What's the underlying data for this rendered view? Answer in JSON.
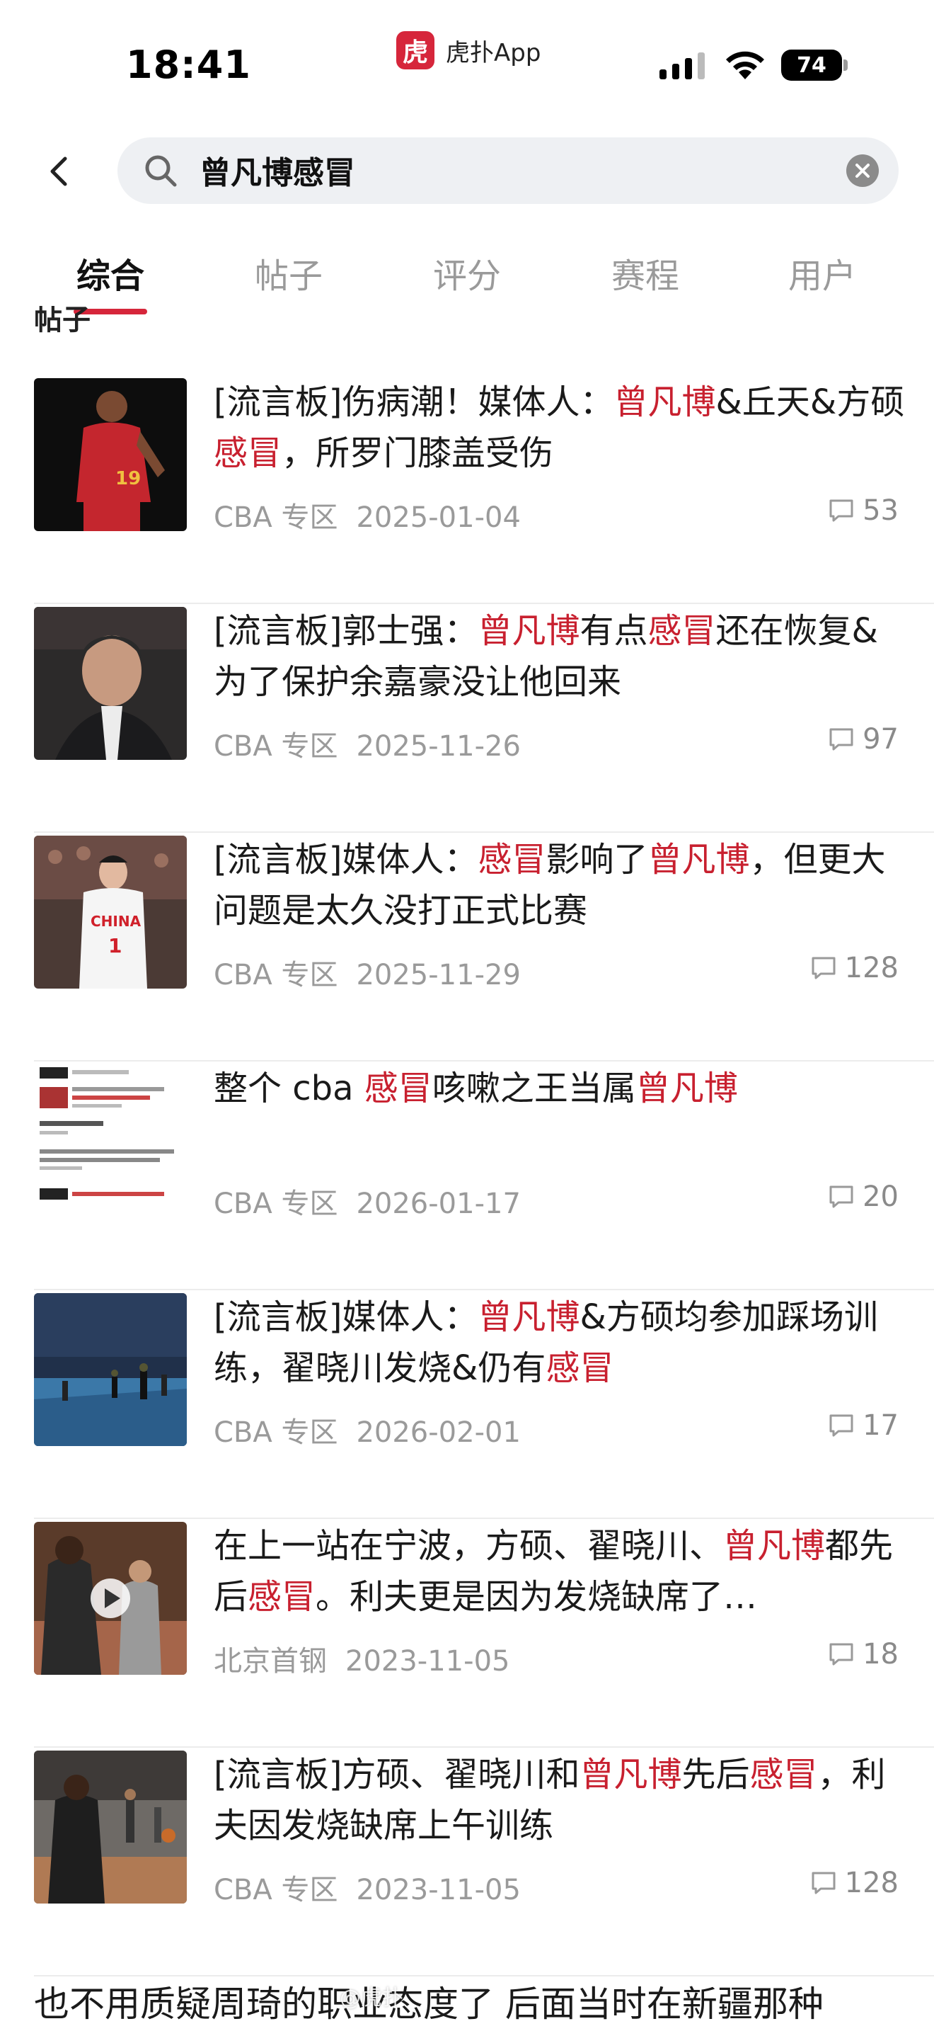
{
  "status_bar": {
    "time": "18:41",
    "app_logo_text": "虎",
    "app_name": "虎扑App",
    "battery": "74"
  },
  "search": {
    "query": "曾凡博感冒",
    "icon": "search-icon"
  },
  "tabs": [
    {
      "label": "综合",
      "active": true
    },
    {
      "label": "帖子",
      "active": false
    },
    {
      "label": "评分",
      "active": false
    },
    {
      "label": "赛程",
      "active": false
    },
    {
      "label": "用户",
      "active": false
    }
  ],
  "section_title": "帖子",
  "colors": {
    "accent": "#d6263b",
    "highlight": "#c8202f",
    "meta": "#9a9a9a"
  },
  "posts": [
    {
      "title_parts": [
        {
          "t": "[流言板]伤病潮！媒体人：",
          "h": false
        },
        {
          "t": "曾凡博",
          "h": true
        },
        {
          "t": "&丘天&方硕",
          "h": false
        },
        {
          "t": "感冒",
          "h": true
        },
        {
          "t": "，所罗门膝盖受伤",
          "h": false
        }
      ],
      "board": "CBA 专区",
      "date": "2025-01-04",
      "comments": "53"
    },
    {
      "title_parts": [
        {
          "t": "[流言板]郭士强：",
          "h": false
        },
        {
          "t": "曾凡博",
          "h": true
        },
        {
          "t": "有点",
          "h": false
        },
        {
          "t": "感冒",
          "h": true
        },
        {
          "t": "还在恢复&为了保护余嘉豪没让他回来",
          "h": false
        }
      ],
      "board": "CBA 专区",
      "date": "2025-11-26",
      "comments": "97"
    },
    {
      "title_parts": [
        {
          "t": "[流言板]媒体人：",
          "h": false
        },
        {
          "t": "感冒",
          "h": true
        },
        {
          "t": "影响了",
          "h": false
        },
        {
          "t": "曾凡博",
          "h": true
        },
        {
          "t": "，但更大问题是太久没打正式比赛",
          "h": false
        }
      ],
      "board": "CBA 专区",
      "date": "2025-11-29",
      "comments": "128"
    },
    {
      "title_parts": [
        {
          "t": "整个 cba ",
          "h": false
        },
        {
          "t": "感冒",
          "h": true
        },
        {
          "t": "咳嗽之王当属",
          "h": false
        },
        {
          "t": "曾凡博",
          "h": true
        }
      ],
      "board": "CBA 专区",
      "date": "2026-01-17",
      "comments": "20"
    },
    {
      "title_parts": [
        {
          "t": "[流言板]媒体人：",
          "h": false
        },
        {
          "t": "曾凡博",
          "h": true
        },
        {
          "t": "&方硕均参加踩场训练，翟晓川发烧&仍有",
          "h": false
        },
        {
          "t": "感冒",
          "h": true
        }
      ],
      "board": "CBA 专区",
      "date": "2026-02-01",
      "comments": "17"
    },
    {
      "title_parts": [
        {
          "t": "在上一站在宁波，方硕、翟晓川、",
          "h": false
        },
        {
          "t": "曾凡博",
          "h": true
        },
        {
          "t": "都先后",
          "h": false
        },
        {
          "t": "感冒",
          "h": true
        },
        {
          "t": "。利夫更是因为发烧缺席了…",
          "h": false
        }
      ],
      "board": "北京首钢",
      "date": "2023-11-05",
      "comments": "18"
    },
    {
      "title_parts": [
        {
          "t": "[流言板]方硕、翟晓川和",
          "h": false
        },
        {
          "t": "曾凡博",
          "h": true
        },
        {
          "t": "先后",
          "h": false
        },
        {
          "t": "感冒",
          "h": true
        },
        {
          "t": "，利夫因发烧缺席上午训练",
          "h": false
        }
      ],
      "board": "CBA 专区",
      "date": "2023-11-05",
      "comments": "128"
    }
  ],
  "last_line": "也不用质疑周琦的职业态度了 后面当时在新疆那种",
  "watermark": "@虎扑"
}
